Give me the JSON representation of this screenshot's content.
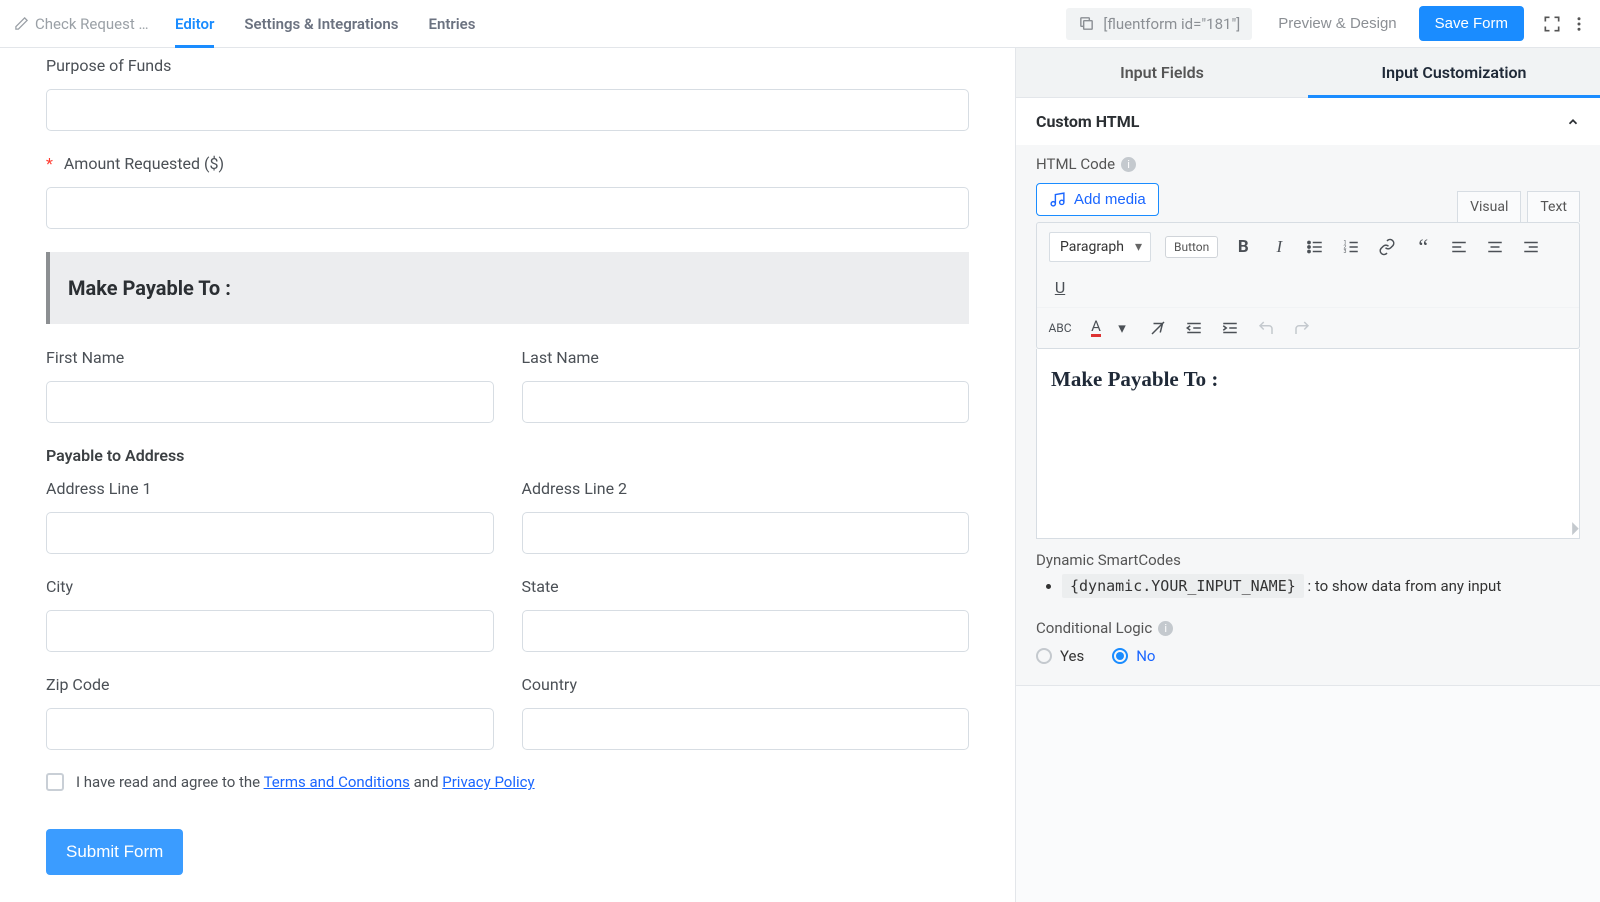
{
  "topbar": {
    "form_title": "Check Request F…",
    "tabs": {
      "editor": "Editor",
      "settings": "Settings & Integrations",
      "entries": "Entries"
    },
    "shortcode": "[fluentform id=\"181\"]",
    "preview": "Preview & Design",
    "save": "Save Form"
  },
  "form": {
    "purpose_label": "Purpose of Funds",
    "amount_label": "Amount Requested ($)",
    "section_title": "Make Payable To :",
    "first_name": "First Name",
    "last_name": "Last Name",
    "address_title": "Payable to Address",
    "address1": "Address Line 1",
    "address2": "Address Line 2",
    "city": "City",
    "state": "State",
    "zip": "Zip Code",
    "country": "Country",
    "agree_prefix": "I have read and agree to the ",
    "terms": "Terms and Conditions",
    "and": " and ",
    "privacy": "Privacy Policy",
    "submit": "Submit Form"
  },
  "side": {
    "tab_fields": "Input Fields",
    "tab_custom": "Input Customization",
    "section_title": "Custom HTML",
    "html_code_label": "HTML Code",
    "add_media": "Add media",
    "visual": "Visual",
    "text": "Text",
    "format": "Paragraph",
    "button_pill": "Button",
    "rte_text": "Make Payable To :",
    "smartcodes_label": "Dynamic SmartCodes",
    "smartcode_example": "{dynamic.YOUR_INPUT_NAME}",
    "smartcode_desc": ": to show data from any input",
    "cond_label": "Conditional Logic",
    "yes": "Yes",
    "no": "No"
  }
}
